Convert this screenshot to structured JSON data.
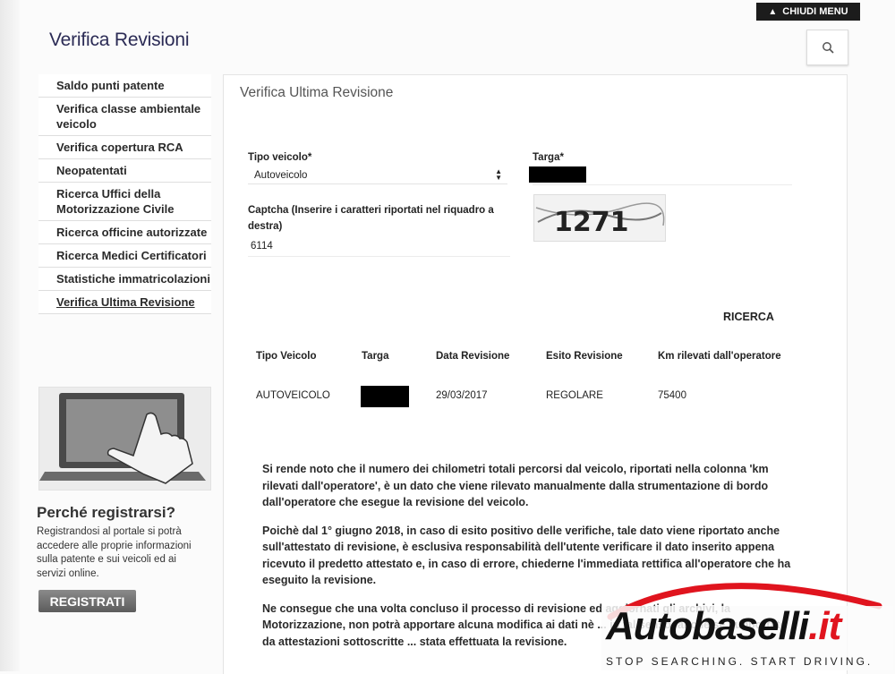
{
  "header": {
    "close_menu": "CHIUDI MENU",
    "page_title": "Verifica Revisioni"
  },
  "sidebar": {
    "items": [
      "Saldo punti patente",
      "Verifica classe ambientale veicolo",
      "Verifica copertura RCA",
      "Neopatentati",
      "Ricerca Uffici della Motorizzazione Civile",
      "Ricerca officine autorizzate",
      "Ricerca Medici Certificatori",
      "Statistiche immatricolazioni",
      "Verifica Ultima Revisione"
    ],
    "why_title": "Perché registrarsi?",
    "why_text": "Registrandosi al portale si potrà accedere alle proprie informazioni sulla patente e sui veicoli ed ai servizi online.",
    "register": "REGISTRATI"
  },
  "form": {
    "title": "Verifica Ultima Revisione",
    "tipo_label": "Tipo veicolo*",
    "tipo_value": "Autoveicolo",
    "targa_label": "Targa*",
    "captcha_label": "Captcha (Inserire i caratteri riportati nel riquadro a destra)",
    "captcha_value": "6114",
    "captcha_image_text": "1271",
    "search": "RICERCA"
  },
  "results": {
    "headers": [
      "Tipo Veicolo",
      "Targa",
      "Data Revisione",
      "Esito Revisione",
      "Km rilevati dall'operatore"
    ],
    "row": {
      "tipo": "AUTOVEICOLO",
      "data": "29/03/2017",
      "esito": "REGOLARE",
      "km": "75400"
    }
  },
  "notes": [
    "Si rende noto che il numero dei chilometri totali percorsi dal veicolo, riportati nella colonna 'km rilevati dall'operatore', è un dato che viene rilevato manualmente dalla strumentazione di bordo dall'operatore che esegue la revisione del veicolo.",
    "Poichè dal 1° giugno 2018, in caso di esito positivo delle verifiche, tale dato viene riportato anche sull'attestato di revisione, è esclusiva responsabilità dell'utente verificare il dato inserito appena ricevuto il predetto attestato e, in caso di errore, chiederne l'immediata rettifica all'operatore che ha eseguito la revisione.",
    "Ne consegue che una volta concluso il processo di revisione ed aggiornati gli archivi, la Motorizzazione, non potrà apportare alcuna modifica ai dati nè ... in tal senso, anche se supportate da attestazioni sottoscritte ... stata effettuata la revisione."
  ],
  "watermark": {
    "brand": "Autobaselli",
    "dot": ".it",
    "tagline": "STOP SEARCHING. START DRIVING."
  },
  "colors": {
    "title": "#2b2b55",
    "brand_red": "#e0141e"
  }
}
